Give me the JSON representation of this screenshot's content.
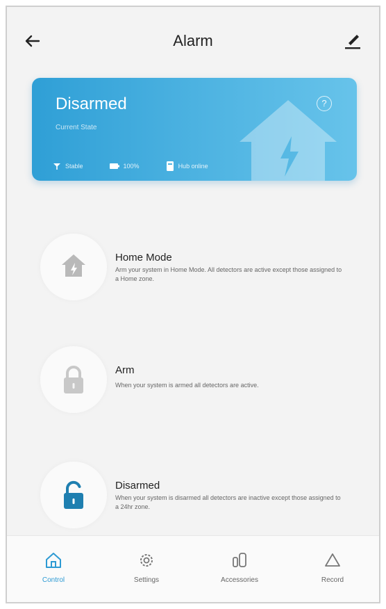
{
  "header": {
    "title": "Alarm"
  },
  "status_card": {
    "title": "Disarmed",
    "subtitle": "Current State",
    "help": "?",
    "items": [
      {
        "icon": "signal-icon",
        "label": "Stable"
      },
      {
        "icon": "battery-icon",
        "label": "100%"
      },
      {
        "icon": "device-icon",
        "label": "Hub online"
      }
    ]
  },
  "modes": [
    {
      "icon": "home-mode-icon",
      "title": "Home Mode",
      "description": "Arm your system in Home Mode. All detectors are active except those assigned to a Home zone."
    },
    {
      "icon": "lock-closed-icon",
      "title": "Arm",
      "description": "When your system is armed all detectors are active."
    },
    {
      "icon": "lock-open-icon",
      "title": "Disarmed",
      "description": "When your system is disarmed all detectors are inactive except those assigned to a 24hr zone."
    }
  ],
  "nav": [
    {
      "icon": "home-icon",
      "label": "Control",
      "active": true
    },
    {
      "icon": "gear-icon",
      "label": "Settings",
      "active": false
    },
    {
      "icon": "accessories-icon",
      "label": "Accessories",
      "active": false
    },
    {
      "icon": "alert-icon",
      "label": "Record",
      "active": false
    }
  ],
  "colors": {
    "accent": "#2d9ad3",
    "card_start": "#2f9fd6",
    "card_end": "#67c3ea"
  }
}
